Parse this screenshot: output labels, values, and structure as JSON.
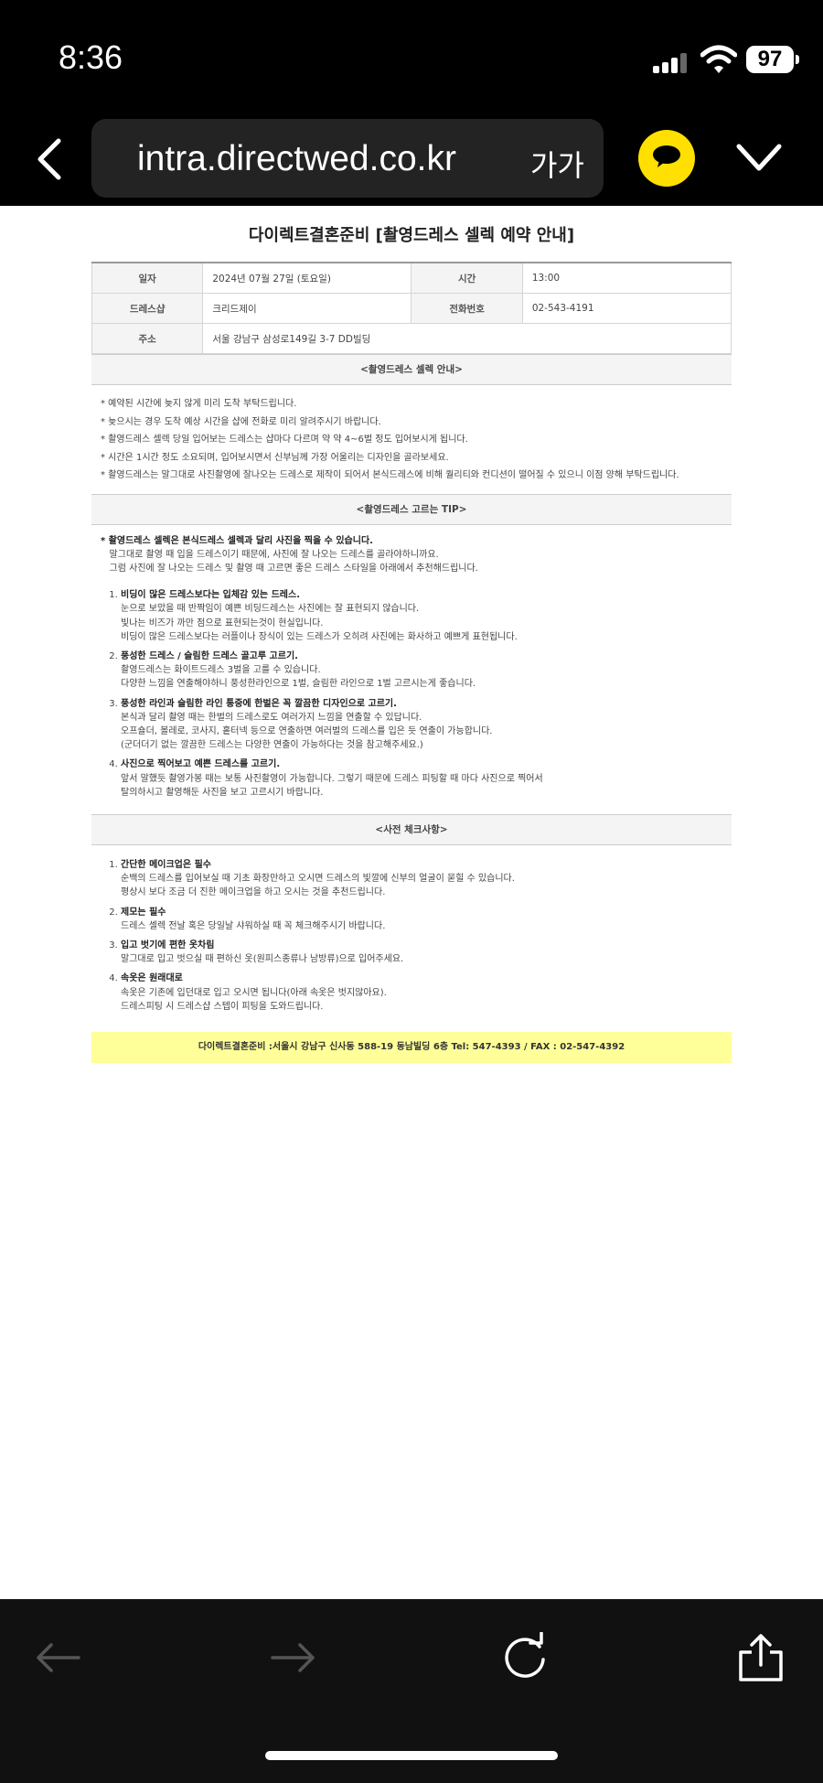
{
  "status": {
    "time": "8:36",
    "battery": "97"
  },
  "browser": {
    "url": "intra.directwed.co.kr",
    "font_size_label": "가가"
  },
  "doc": {
    "title": "다이렉트결혼준비 [촬영드레스 셀렉 예약 안내]",
    "info": {
      "date_label": "일자",
      "date_value": "2024년 07월 27일 (토요일)",
      "time_label": "시간",
      "time_value": "13:00",
      "shop_label": "드레스샵",
      "shop_value": "크리드제이",
      "phone_label": "전화번호",
      "phone_value": "02-543-4191",
      "address_label": "주소",
      "address_value": "서울 강남구 삼성로149길 3-7 DD빌딩"
    },
    "guide_header": "<촬영드레스 셀렉 안내>",
    "guide_notes": [
      "* 예약된 시간에 늦지 않게 미리 도착 부탁드립니다.",
      "* 늦으시는 경우 도착 예상 시간을 샵에 전화로 미리 알려주시기 바랍니다.",
      "* 촬영드레스 셀렉 당일 입어보는 드레스는 샵마다 다르며 약 약 4~6벌 정도 입어보시게 됩니다.",
      "* 시간은 1시간 정도 소요되며, 입어보시면서 신부님께 가장 어울리는 디자인을 골라보세요.",
      "* 촬영드레스는 말그대로 사진촬영에 잘나오는 드레스로 제작이 되어서 본식드레스에 비해 퀄리티와 컨디션이 떨어질 수 있으니 이점 양해 부탁드립니다."
    ],
    "tip_header": "<촬영드레스 고르는 TIP>",
    "tip_lead": {
      "bold": "* 촬영드레스 셀렉은 본식드레스 셀렉과 달리 사진을 찍을 수 있습니다.",
      "line2": "말그대로 촬영 때 입을 드레스이기 때문에, 사진에 잘 나오는 드레스를 골라야하니까요.",
      "line3": "그럼 사진에 잘 나오는 드레스 및 촬영 때 고르면 좋은 드레스 스타일을 아래에서 추천해드립니다."
    },
    "tips": [
      {
        "title": "비딩이 많은 드레스보다는 입체감 있는 드레스.",
        "lines": [
          "눈으로 보았을 때 반짝임이 예쁜 비딩드레스는 사진에는 잘 표현되지 않습니다.",
          "빛나는 비즈가 까만 점으로 표현되는것이 현실입니다.",
          "비딩이 많은 드레스보다는 러플이나 장식이 있는 드레스가 오히려 사진에는 화사하고 예쁘게 표현됩니다."
        ]
      },
      {
        "title": "풍성한 드레스 / 슬림한 드레스 골고루 고르기.",
        "lines": [
          "촬영드레스는 화이트드레스 3벌을 고를 수 있습니다.",
          "다양한 느낌을 연출해야하니 풍성한라인으로 1벌, 슬림한 라인으로 1벌 고르시는게 좋습니다."
        ]
      },
      {
        "title": "풍성한 라인과 슬림한 라인 통중에 한벌은 꼭 깔끔한 디자인으로 고르기.",
        "lines": [
          "본식과 달리 촬영 때는 한벌의 드레스로도 여러가지 느낌을 연출할 수 있답니다.",
          "오프숄더, 볼레로, 코사지, 홑터넥 등으로 연출하면 여러벌의 드레스를 입은 듯 연출이 가능합니다.",
          "(군더더기 없는 깔끔한 드레스는 다양한 연출이 가능하다는 것을 참고해주세요.)"
        ]
      },
      {
        "title": "사진으로 찍어보고 예쁜 드레스를 고르기.",
        "lines": [
          "앞서 말했듯 촬영가봉 때는 보통 사진촬영이 가능합니다. 그렇기 때문에 드레스 피팅할 때 마다 사진으로 찍어서",
          "탈의하시고 촬영해둔 사진을 보고 고르시기 바랍니다."
        ]
      }
    ],
    "check_header": "<사전 체크사항>",
    "checks": [
      {
        "title": "간단한 메이크업은 필수",
        "lines": [
          "순백의 드레스를 입어보실 때 기초 화장만하고 오시면 드레스의 빛깔에 신부의 얼굴이 묻힐 수 있습니다.",
          "평상시 보다 조금 더 진한 메이크업을 하고 오시는 것을 추천드립니다."
        ]
      },
      {
        "title": "제모는 필수",
        "lines": [
          "드레스 셀렉 전날 혹은 당일날 샤워하실 때 꼭 체크해주시기 바랍니다."
        ]
      },
      {
        "title": "입고 벗기에 편한 옷차림",
        "lines": [
          "말그대로 입고 벗으실 때 편하신 옷(원피스종류나 남방류)으로 입어주세요."
        ]
      },
      {
        "title": "속옷은 원래대로",
        "lines": [
          "속옷은 기존에 입던대로 입고 오시면 됩니다(아래 속옷은 벗지않아요).",
          "드레스피팅 시 드레스샵 스텝이 피팅을 도와드립니다."
        ]
      }
    ],
    "footer": "다이렉트결혼준비 :서울시 강남구 신사동 588-19 동남빌딩 6층 Tel: 547-4393 / FAX : 02-547-4392"
  },
  "colors": {
    "accent_yellow": "#ffe000",
    "footer_bg": "#ffff99"
  },
  "icons": [
    "back-chevron-icon",
    "talk-icon",
    "chevron-down-icon",
    "arrow-left-icon",
    "arrow-right-icon",
    "reload-icon",
    "share-icon"
  ]
}
